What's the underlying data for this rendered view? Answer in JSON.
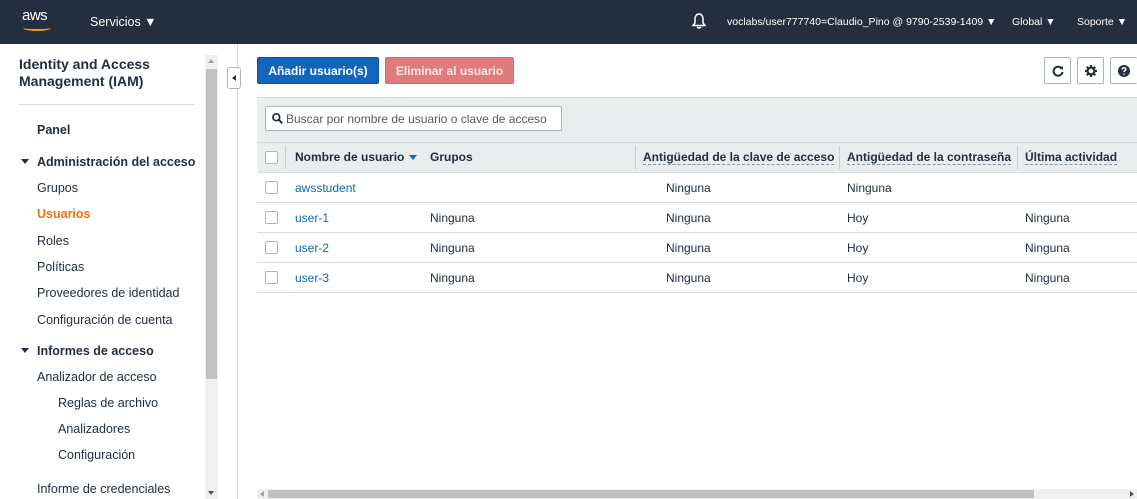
{
  "topnav": {
    "logo_text": "aws",
    "services_label": "Servicios ▼",
    "account_label": "voclabs/user777740=Claudio_Pino @ 9790-2539-1409 ▼",
    "region_label": "Global ▼",
    "support_label": "Soporte ▼"
  },
  "sidebar": {
    "title": "Identity and Access Management (IAM)",
    "panel": "Panel",
    "section_access": "Administración del acceso",
    "items_access": [
      "Grupos",
      "Usuarios",
      "Roles",
      "Políticas",
      "Proveedores de identidad",
      "Configuración de cuenta"
    ],
    "active_item": "Usuarios",
    "section_reports": "Informes de acceso",
    "items_reports": [
      "Analizador de acceso",
      "Reglas de archivo",
      "Analizadores",
      "Configuración",
      "Informe de credenciales"
    ]
  },
  "toolbar": {
    "add_label": "Añadir usuario(s)",
    "delete_label": "Eliminar al usuario"
  },
  "search": {
    "placeholder": "Buscar por nombre de usuario o clave de acceso"
  },
  "table": {
    "columns": [
      "Nombre de usuario",
      "Grupos",
      "Antigüedad de la clave de acceso",
      "Antigüedad de la contraseña",
      "Última actividad"
    ],
    "rows": [
      {
        "user": "awsstudent",
        "groups": "",
        "key_age": "Ninguna",
        "password_age": "Ninguna",
        "last_activity": ""
      },
      {
        "user": "user-1",
        "groups": "Ninguna",
        "key_age": "Ninguna",
        "password_age": "Hoy",
        "last_activity": "Ninguna"
      },
      {
        "user": "user-2",
        "groups": "Ninguna",
        "key_age": "Ninguna",
        "password_age": "Hoy",
        "last_activity": "Ninguna"
      },
      {
        "user": "user-3",
        "groups": "Ninguna",
        "key_age": "Ninguna",
        "password_age": "Hoy",
        "last_activity": "Ninguna"
      }
    ]
  },
  "colors": {
    "nav_bg": "#232f3e",
    "primary_button": "#1166bb",
    "danger_button_disabled": "#e07b7b",
    "active_nav": "#ec7211",
    "link": "#1166bb"
  }
}
